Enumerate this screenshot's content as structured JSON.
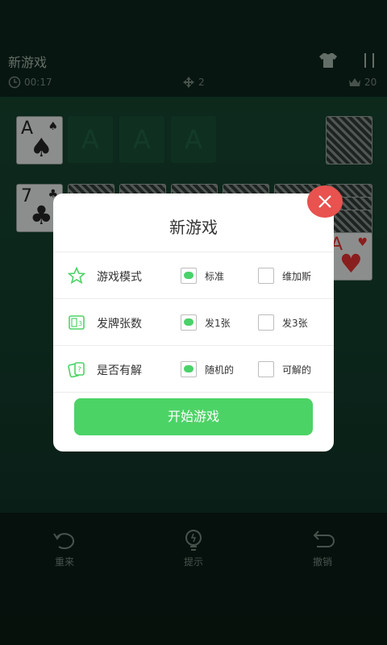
{
  "header": {
    "title": "新游戏",
    "time": "00:17",
    "moves": "2",
    "score": "20"
  },
  "board": {
    "foundation": [
      "A",
      "A",
      "A"
    ],
    "cards": {
      "ace_spade": {
        "rank": "A",
        "suit": "♠"
      },
      "seven_club": {
        "rank": "7",
        "suit": "♣"
      },
      "ace_heart": {
        "rank": "A",
        "suit": "♥"
      }
    }
  },
  "dialog": {
    "title": "新游戏",
    "rows": [
      {
        "label": "游戏模式",
        "option1": "标准",
        "option2": "维加斯",
        "selected": 1
      },
      {
        "label": "发牌张数",
        "option1": "发1张",
        "option2": "发3张",
        "selected": 1
      },
      {
        "label": "是否有解",
        "option1": "随机的",
        "option2": "可解的",
        "selected": 1
      }
    ],
    "start_label": "开始游戏"
  },
  "toolbar": {
    "restart": "重来",
    "hint": "提示",
    "undo": "撤销"
  },
  "colors": {
    "accent": "#4cd366",
    "close": "#e8524f"
  }
}
